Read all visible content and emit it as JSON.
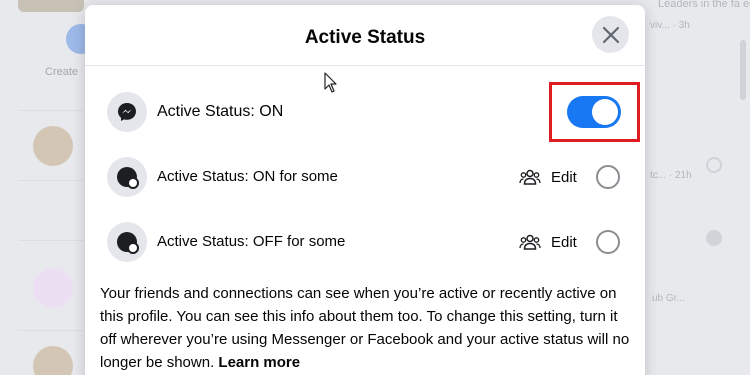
{
  "background": {
    "create_label": "Create",
    "right_texts": [
      "Leaders in the fa eeee",
      "viv... · 3h",
      "tc... · 21h",
      "ub Gr..."
    ]
  },
  "modal": {
    "title": "Active Status",
    "close_icon": "close-icon"
  },
  "rows": [
    {
      "label": "Active Status: ON",
      "icon": "messenger-icon",
      "control": "toggle",
      "on": true
    },
    {
      "label": "Active Status: ON for some",
      "icon": "status-dot-icon",
      "edit_label": "Edit",
      "edit_icon": "people-icon"
    },
    {
      "label": "Active Status: OFF for some",
      "icon": "status-dot-icon",
      "edit_label": "Edit",
      "edit_icon": "people-icon"
    }
  ],
  "description": {
    "text": "Your friends and connections can see when you’re active or recently active on this profile. You can see this info about them too. To change this setting, turn it off wherever you’re using Messenger or Facebook and your active status will no longer be shown.",
    "link": "Learn more"
  },
  "colors": {
    "accent": "#1877f2",
    "highlight": "#e11b22"
  }
}
